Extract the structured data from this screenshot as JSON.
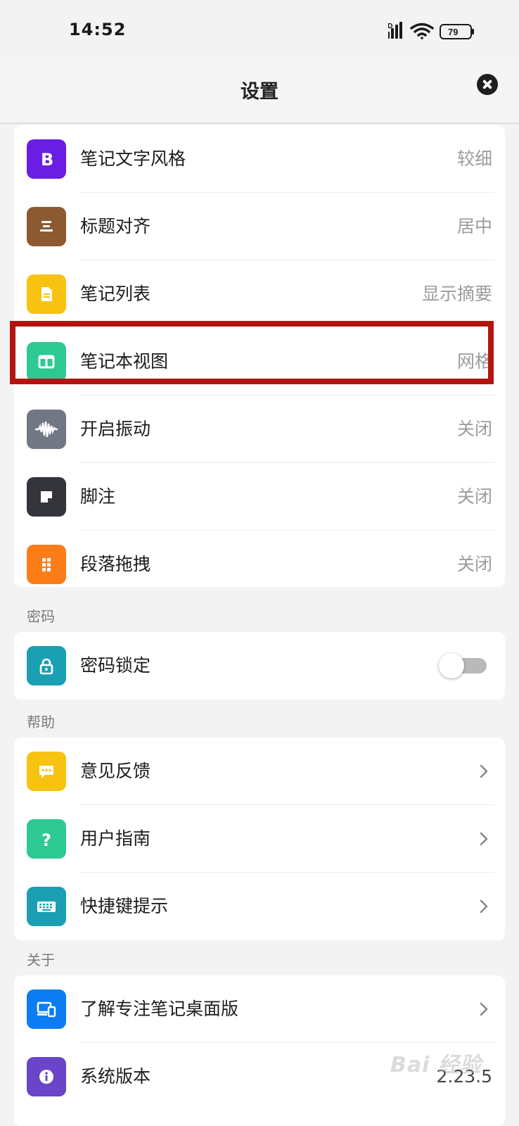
{
  "status_bar": {
    "time": "14:52",
    "network_label": "HD",
    "battery_level": "79"
  },
  "header": {
    "title": "设置",
    "close_icon": "close-icon"
  },
  "settings": [
    {
      "label": "笔记文字风格",
      "value": "较细",
      "icon": "bold-icon",
      "color": "#6a1de3"
    },
    {
      "label": "标题对齐",
      "value": "居中",
      "icon": "align-center-icon",
      "color": "#8b5a31"
    },
    {
      "label": "笔记列表",
      "value": "显示摘要",
      "icon": "document-icon",
      "color": "#f7c210"
    },
    {
      "label": "笔记本视图",
      "value": "网格",
      "icon": "grid-view-icon",
      "color": "#2dc992"
    },
    {
      "label": "开启振动",
      "value": "关闭",
      "icon": "waveform-icon",
      "color": "#717784"
    },
    {
      "label": "脚注",
      "value": "关闭",
      "icon": "note-icon",
      "color": "#34353b"
    },
    {
      "label": "段落拖拽",
      "value": "关闭",
      "icon": "drag-handle-icon",
      "color": "#fb7d19"
    }
  ],
  "password_section": {
    "title": "密码",
    "items": [
      {
        "label": "密码锁定",
        "icon": "lock-icon",
        "color": "#1aa0b2",
        "toggle_on": false
      }
    ]
  },
  "help_section": {
    "title": "帮助",
    "items": [
      {
        "label": "意见反馈",
        "icon": "chat-icon",
        "color": "#f7c210"
      },
      {
        "label": "用户指南",
        "icon": "question-icon",
        "color": "#2dc992"
      },
      {
        "label": "快捷键提示",
        "icon": "keyboard-icon",
        "color": "#1aa0b2"
      }
    ]
  },
  "about_section": {
    "title": "关于",
    "items": [
      {
        "label": "了解专注笔记桌面版",
        "icon": "devices-icon",
        "color": "#0c7cf3"
      },
      {
        "label": "系统版本",
        "value": "2.23.5",
        "icon": "info-icon",
        "color": "#6a44c9"
      }
    ]
  },
  "watermark": {
    "text": "Bai 经验"
  }
}
